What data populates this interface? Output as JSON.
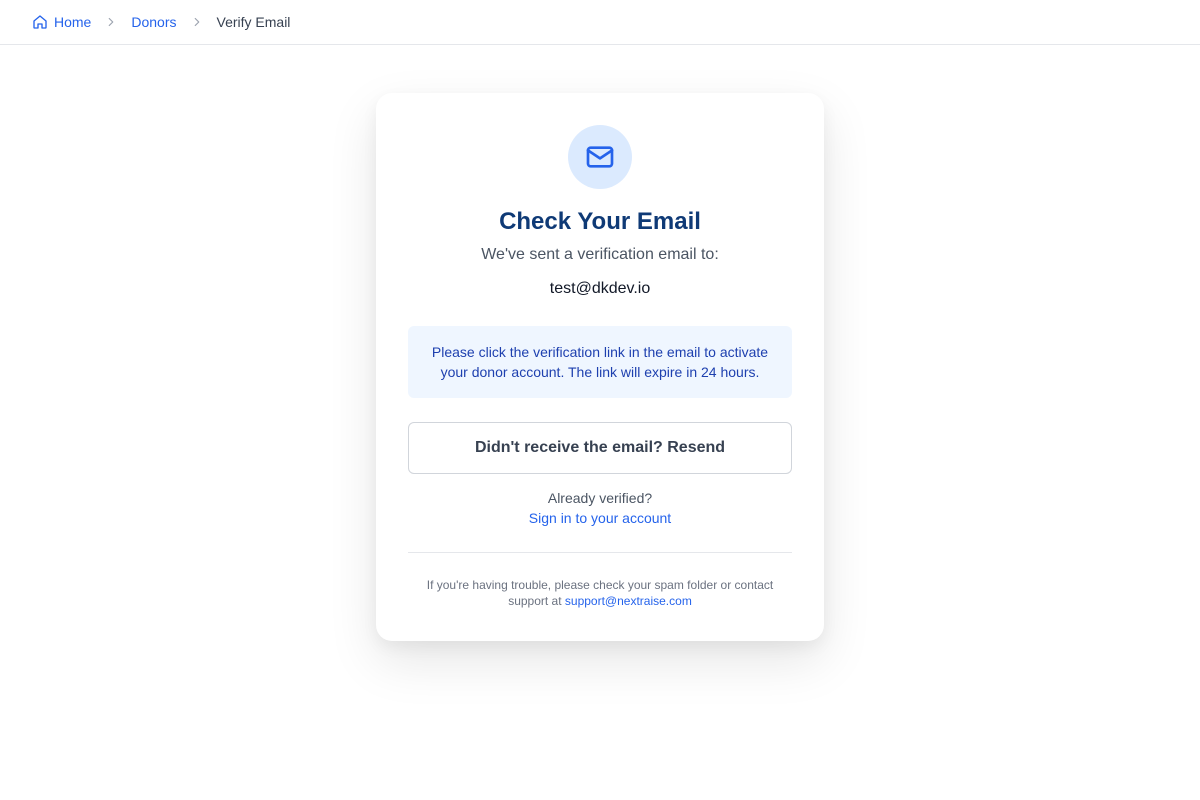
{
  "breadcrumb": {
    "items": [
      {
        "label": "Home",
        "icon": "home-icon"
      },
      {
        "label": "Donors"
      },
      {
        "label": "Verify Email"
      }
    ]
  },
  "card": {
    "icon": "mail-icon",
    "title": "Check Your Email",
    "subtitle": "We've sent a verification email to:",
    "email": "test@dkdev.io",
    "notice": "Please click the verification link in the email to activate your donor account. The link will expire in 24 hours.",
    "resend_label": "Didn't receive the email? Resend",
    "already_verified": "Already verified?",
    "signin_label": "Sign in to your account",
    "help_text": "If you're having trouble, please check your spam folder or contact support at",
    "support_email": "support@nextraise.com"
  },
  "colors": {
    "accent": "#2563eb",
    "title": "#0f3a76",
    "icon_bg": "#dbeafe",
    "notice_bg": "#eff6ff"
  }
}
